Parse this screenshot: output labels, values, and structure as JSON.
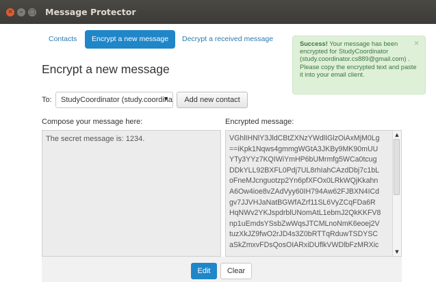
{
  "window": {
    "title": "Message Protector"
  },
  "tabs": [
    {
      "label": "Contacts",
      "active": false
    },
    {
      "label": "Encrypt a new message",
      "active": true
    },
    {
      "label": "Decrypt a received message",
      "active": false
    }
  ],
  "alert": {
    "strong": "Success!",
    "text": " Your message has been encrypted for StudyCoordinator (study.coordinator.cs889@gmail.com) . Please copy the encrypted text and paste it into your email client.",
    "close": "×"
  },
  "page": {
    "heading": "Encrypt a new message"
  },
  "recipient": {
    "label": "To:",
    "selected": "StudyCoordinator (study.coordinator.cs889@gmail.com)",
    "add_contact": "Add new contact"
  },
  "compose": {
    "label": "Compose your message here:",
    "value": "The secret message is: 1234."
  },
  "encrypted": {
    "label": "Encrypted message:",
    "lines": [
      "VGhlIHNlY3JldCBtZXNzYWdlIGlzOiAxMjM0Lg",
      "==iKpk1Nqws4gmmgWGtA3JKBy9MK90mUU",
      "YTy3YYz7KQIWiYmHP6bUMrmfg5WCa0tcug",
      "DDkYLL92BXFL0Pdj7UL8rhIahCAzdDbj7c1bL",
      "oFneMJcnguotzp2Yn6pfXFOx0LRkWQjKkahn",
      "A6Ow4ioe8vZAdVyy60IH794Aw62FJBXN4ICd",
      "gv7JJVHJaNatBGWfAZrf11SL6VyZCqFDa6R",
      "HqNWv2YKJspdrblUNomAtL1ebmJ2QkKKFV8",
      "np1uEmdsYSsbZwWqsJTCMLnoNmK6eoej2V",
      "tuzXkJZ9fwO2rJD4s3Z0bRTTqRduwTSDYSC",
      "aSkZmxvFDsQosOIARxiDUflkVWDlbFzMRXic"
    ]
  },
  "actions": {
    "edit": "Edit",
    "clear": "Clear"
  }
}
